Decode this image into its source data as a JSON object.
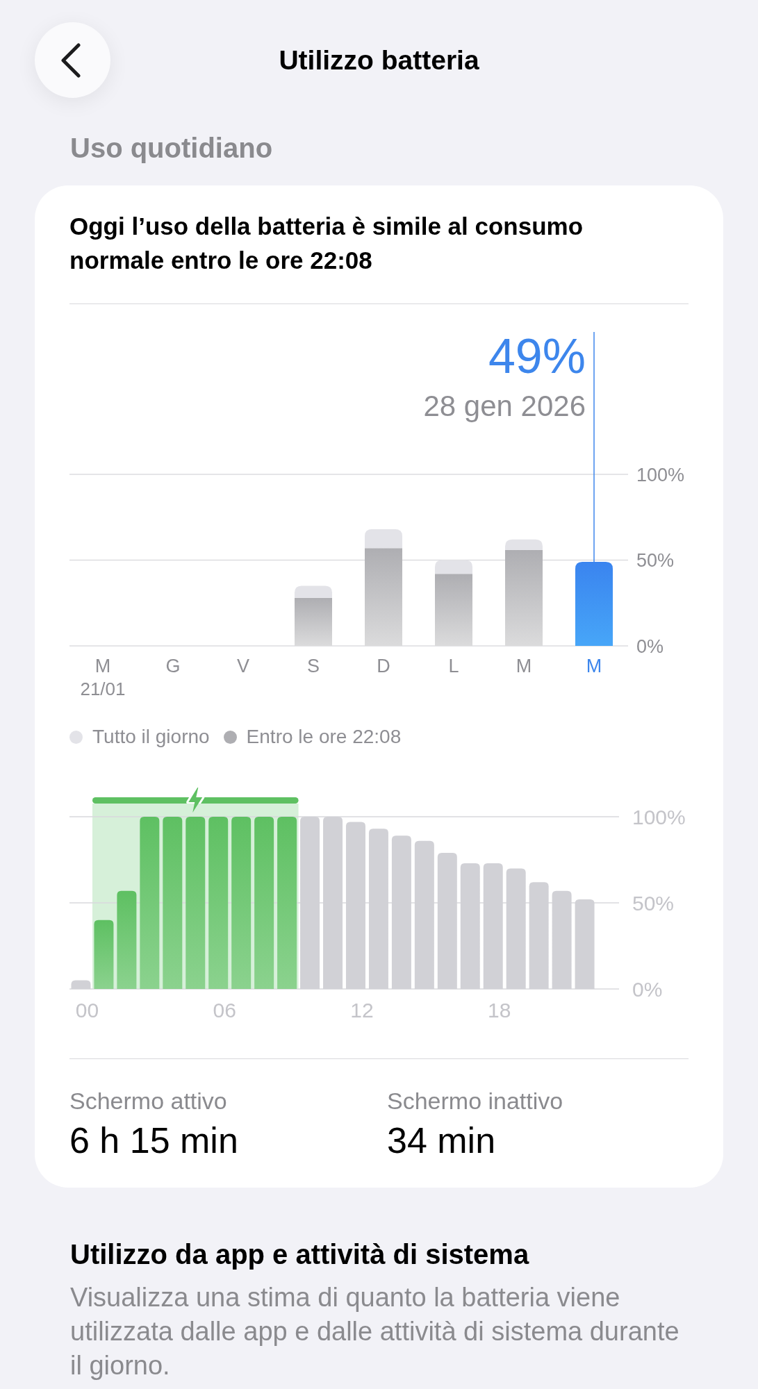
{
  "header": {
    "title": "Utilizzo batteria"
  },
  "section": {
    "title": "Uso quotidiano"
  },
  "card": {
    "summary": "Oggi l’uso della batteria è simile al consumo normale entro le ore 22:08",
    "daily_chart": {
      "readout": {
        "value": "49%",
        "date": "28 gen 2026"
      },
      "days": [
        {
          "selected": false,
          "date": "21/01"
        },
        {
          "selected": false
        },
        {
          "selected": false
        },
        {
          "selected": false
        },
        {
          "selected": false
        },
        {
          "selected": false
        },
        {
          "selected": false
        },
        {
          "selected": true
        }
      ],
      "chart_data": {
        "type": "bar",
        "stacked": true,
        "categories": [
          "M",
          "G",
          "V",
          "S",
          "D",
          "L",
          "M",
          "M"
        ],
        "series": [
          {
            "name": "Entro le ore 22:08",
            "color": "#aeaeb2",
            "values": [
              null,
              null,
              null,
              28,
              57,
              42,
              56,
              49
            ]
          },
          {
            "name": "Tutto il giorno",
            "color": "#e3e3e8",
            "values": [
              null,
              null,
              null,
              7,
              11,
              8,
              6,
              null
            ]
          }
        ],
        "ylim": [
          0,
          183
        ],
        "yticks": [
          {
            "value": 0,
            "label": "0%"
          },
          {
            "value": 50,
            "label": "50%"
          },
          {
            "value": 100,
            "label": "100%"
          }
        ]
      }
    },
    "hourly_chart": {
      "chart_data": {
        "type": "bar",
        "x": [
          0,
          1,
          2,
          3,
          4,
          5,
          6,
          7,
          8,
          9,
          10,
          11,
          12,
          13,
          14,
          15,
          16,
          17,
          18,
          19,
          20,
          21,
          22
        ],
        "series": [
          {
            "color": "#5ec062",
            "values": [
              null,
              40,
              57,
              100,
              100,
              100,
              100,
              100,
              100,
              100,
              null,
              null,
              null,
              null,
              null,
              null,
              null,
              null,
              null,
              null,
              null,
              null,
              null
            ]
          },
          {
            "color": "#d1d1d6",
            "values": [
              5,
              null,
              null,
              null,
              null,
              null,
              null,
              null,
              null,
              null,
              100,
              100,
              97,
              93,
              89,
              86,
              79,
              73,
              73,
              70,
              62,
              57,
              52
            ]
          }
        ],
        "bands": [
          {
            "axis": "x",
            "from": 0.5,
            "to": 9.5,
            "color": "#d6f0d9"
          }
        ],
        "xlim": [
          -0.5,
          23.5
        ],
        "ylim": [
          0,
          100
        ],
        "yticks": [
          {
            "value": 0,
            "label": "0%"
          },
          {
            "value": 50,
            "label": "50%"
          },
          {
            "value": 100,
            "label": "100%"
          }
        ],
        "xticks": [
          {
            "value": 0,
            "label": "00"
          },
          {
            "value": 6,
            "label": "06"
          },
          {
            "value": 12,
            "label": "12"
          },
          {
            "value": 18,
            "label": "18"
          }
        ]
      }
    },
    "stats": [
      {
        "label": "Schermo attivo",
        "value": "6 h 15 min"
      },
      {
        "label": "Schermo inattivo",
        "value": "34 min"
      }
    ]
  },
  "app_usage": {
    "title": "Utilizzo da app e attività di sistema",
    "description": "Visualizza una stima di quanto la batteria viene utilizzata dalle app e dalle attività di sistema durante il giorno."
  }
}
